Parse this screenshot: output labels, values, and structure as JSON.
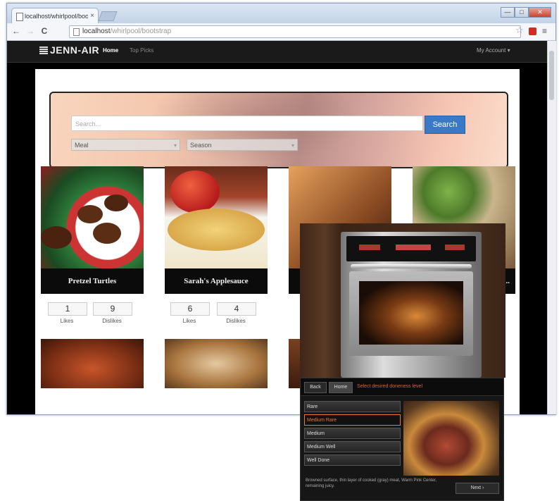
{
  "browser": {
    "tab_title": "localhost/whirlpool/boot",
    "tab_close": "×",
    "url_host": "localhost",
    "url_path": "/whirlpool/bootstrap",
    "nav_back": "←",
    "nav_forward": "→",
    "nav_reload": "C",
    "star": "☆",
    "menu": "≡",
    "win_min": "—",
    "win_max": "□",
    "win_close": "✕"
  },
  "site": {
    "brand": "JENN-AIR",
    "nav_home": "Home",
    "nav_top_picks": "Top Picks",
    "account": "My Account ▾"
  },
  "search": {
    "placeholder": "Search...",
    "button": "Search",
    "meal": "Meal",
    "season": "Season",
    "caret": "▾"
  },
  "cards": [
    {
      "title": "Pretzel Turtles",
      "likes": "1",
      "dislikes": "9"
    },
    {
      "title": "Sarah's Applesauce",
      "likes": "6",
      "dislikes": "4"
    },
    {
      "title": "",
      "likes": "",
      "dislikes": ""
    },
    {
      "title": "...",
      "likes": "",
      "dislikes": ""
    }
  ],
  "labels": {
    "likes": "Likes",
    "dislikes": "Dislikes"
  },
  "oven_ui": {
    "back": "Back",
    "home": "Home",
    "instruction": "Select desired doneness level",
    "options": [
      "Rare",
      "Medium Rare",
      "Medium",
      "Medium Well",
      "Well Done"
    ],
    "selected_index": 1,
    "description": "Browned surface, thin layer of cooked (gray) meat, Warm Pink Center, remaining juicy.",
    "next": "Next ›"
  },
  "colors": {
    "search_button": "#3a78c8",
    "oven_accent": "#e8783c"
  }
}
